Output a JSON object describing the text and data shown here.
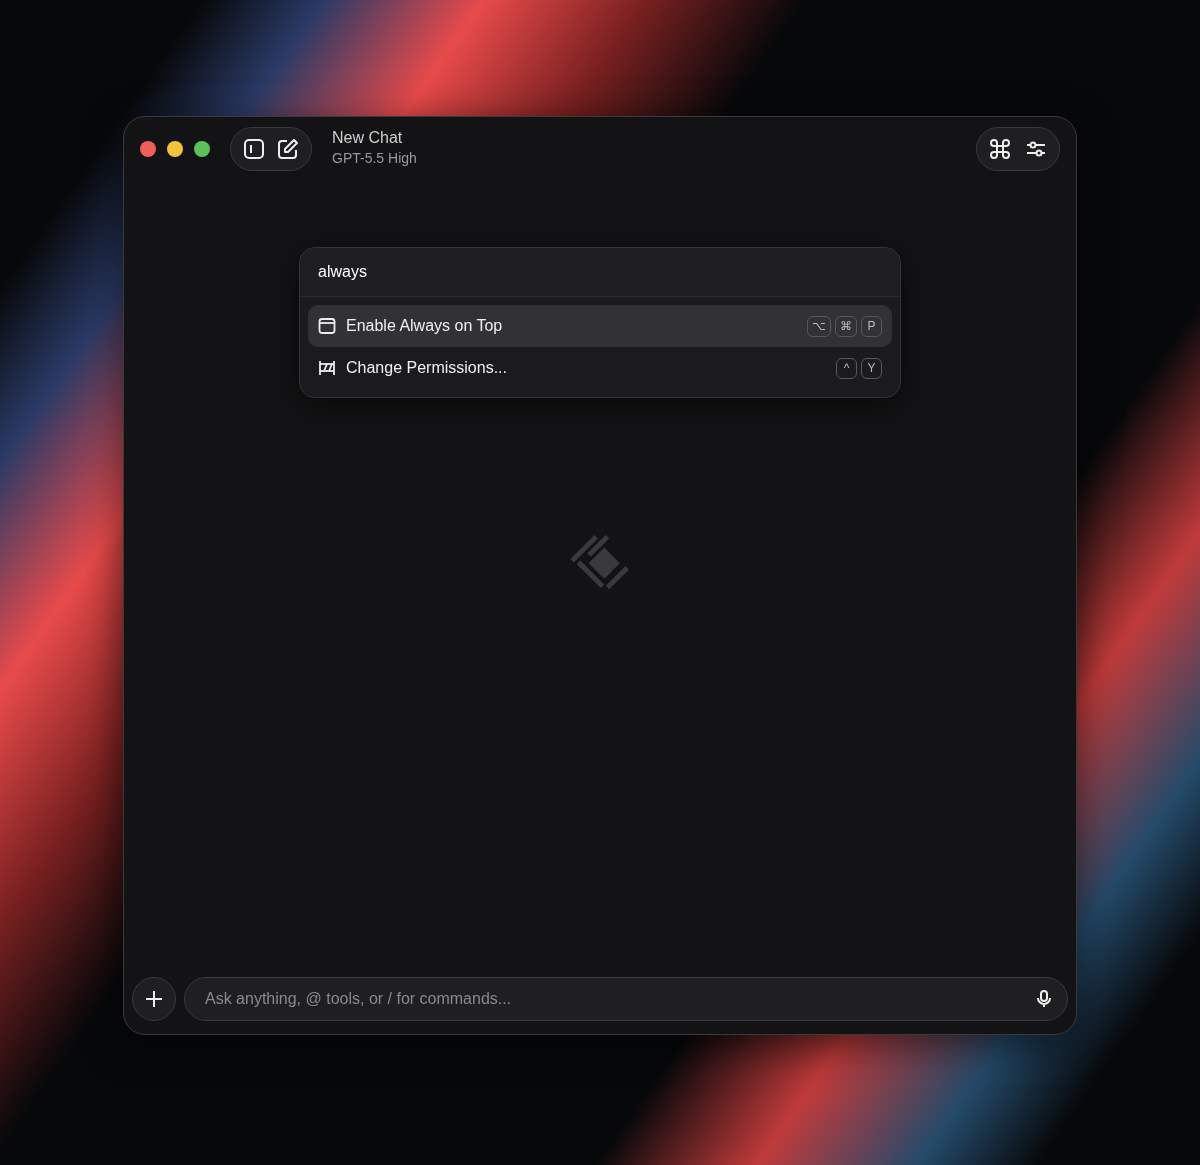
{
  "window": {
    "title": "New Chat",
    "subtitle": "GPT-5.5 High"
  },
  "palette": {
    "query": "always",
    "commands": [
      {
        "label": "Enable Always on Top",
        "kind": "window",
        "selected": true,
        "keys": [
          "⌥",
          "⌘",
          "P"
        ]
      },
      {
        "label": "Change Permissions...",
        "kind": "permissions",
        "selected": false,
        "keys": [
          "^",
          "Y"
        ]
      }
    ]
  },
  "composer": {
    "placeholder": "Ask anything, @ tools, or / for commands..."
  }
}
